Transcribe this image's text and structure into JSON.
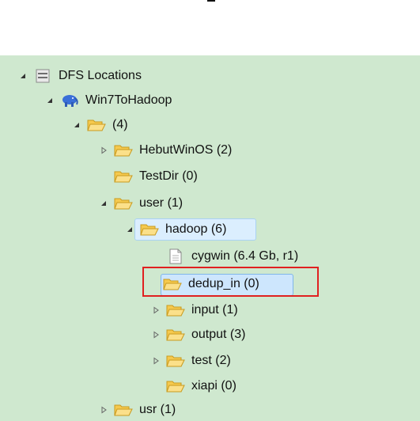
{
  "tree": {
    "root": {
      "label": "DFS Locations",
      "icon": "dfs-locations-icon"
    },
    "location": {
      "label": "Win7ToHadoop",
      "icon": "hadoop-elephant-icon"
    },
    "root_dir": {
      "label": "(4)"
    },
    "hebutwinos": {
      "label": "HebutWinOS (2)"
    },
    "testdir": {
      "label": "TestDir (0)"
    },
    "user": {
      "label": "user (1)"
    },
    "hadoop": {
      "label": "hadoop (6)"
    },
    "cygwin": {
      "label": "cygwin (6.4 Gb, r1)"
    },
    "dedup_in": {
      "label": "dedup_in (0)"
    },
    "input": {
      "label": "input (1)"
    },
    "output": {
      "label": "output (3)"
    },
    "test": {
      "label": "test (2)"
    },
    "xiapi": {
      "label": "xiapi (0)"
    },
    "usr": {
      "label": "usr (1)"
    }
  },
  "colors": {
    "panel_bg": "#cfe8cf",
    "highlight": "#e02020",
    "selection": "#cde6fd",
    "folder": "#f5c94e"
  }
}
